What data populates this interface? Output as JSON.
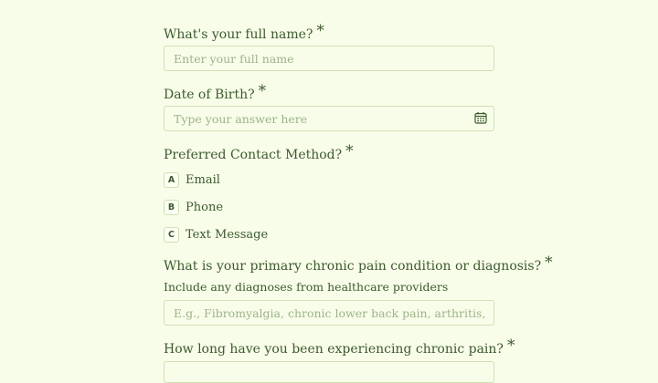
{
  "form": {
    "required_mark": "*",
    "q1": {
      "label": "What's your full name?",
      "placeholder": "Enter your full name"
    },
    "q2": {
      "label": "Date of Birth?",
      "placeholder": "Type your answer here",
      "icon": "calendar-icon"
    },
    "q3": {
      "label": "Preferred Contact Method?",
      "options": [
        {
          "key": "A",
          "label": "Email"
        },
        {
          "key": "B",
          "label": "Phone"
        },
        {
          "key": "C",
          "label": "Text Message"
        }
      ]
    },
    "q4": {
      "label": "What is your primary chronic pain condition or diagnosis?",
      "helper": "Include any diagnoses from healthcare providers",
      "placeholder": "E.g., Fibromyalgia, chronic lower back pain, arthritis, neuropathy,"
    },
    "q5": {
      "label": "How long have you been experiencing chronic pain?"
    }
  },
  "colors": {
    "background": "#f8fde9",
    "text": "#3c5a2e",
    "border": "#cfe0b3",
    "placeholder": "#9db38a"
  }
}
